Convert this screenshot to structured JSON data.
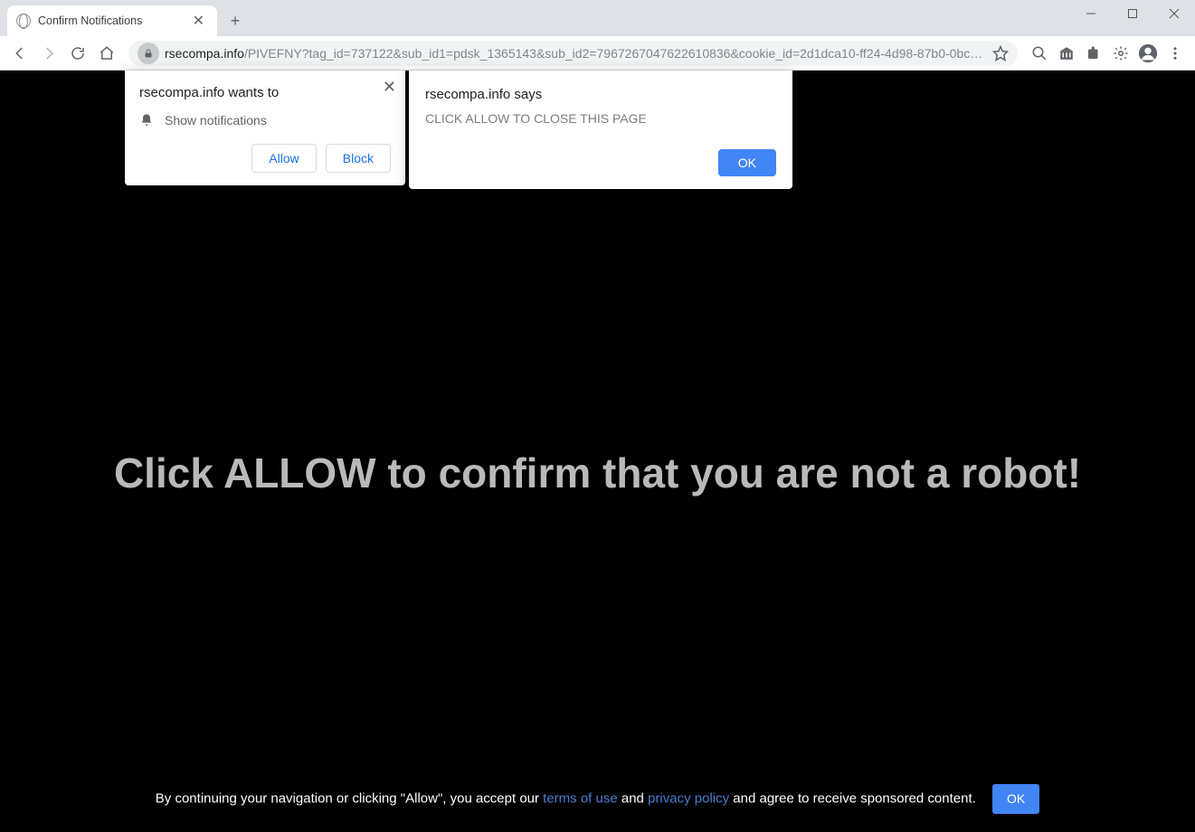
{
  "window": {
    "minimize": "—",
    "maximize": "☐",
    "close": "✕"
  },
  "tab": {
    "title": "Confirm Notifications",
    "close": "✕",
    "new_tab": "+"
  },
  "address_bar": {
    "host": "rsecompa.info",
    "path_query": "/PIVEFNY?tag_id=737122&sub_id1=pdsk_1365143&sub_id2=7967267047622610836&cookie_id=2d1dca10-ff24-4d98-87b0-0bc…"
  },
  "toolbar_icons": {
    "back": "back-icon",
    "forward": "forward-icon",
    "reload": "reload-icon",
    "home": "home-icon",
    "lock": "lock-icon",
    "star": "star-icon",
    "zoom": "zoom-icon",
    "museum": "museum-icon",
    "puzzle": "puzzle-icon",
    "settings": "gear-icon",
    "profile": "profile-icon",
    "menu": "menu-icon"
  },
  "permission_prompt": {
    "origin_wants_to": "rsecompa.info wants to",
    "permission_label": "Show notifications",
    "allow_label": "Allow",
    "block_label": "Block",
    "close": "✕"
  },
  "js_alert": {
    "origin_says": "rsecompa.info says",
    "message": "CLICK ALLOW TO CLOSE THIS PAGE",
    "ok_label": "OK"
  },
  "page": {
    "headline": "Click ALLOW to confirm that you are not a robot!",
    "consent_prefix": "By continuing your navigation or clicking \"Allow\", you accept our ",
    "terms_link": "terms of use",
    "consent_and": " and ",
    "privacy_link": "privacy policy",
    "consent_suffix": " and agree to receive sponsored content.",
    "ok_label": "OK"
  }
}
